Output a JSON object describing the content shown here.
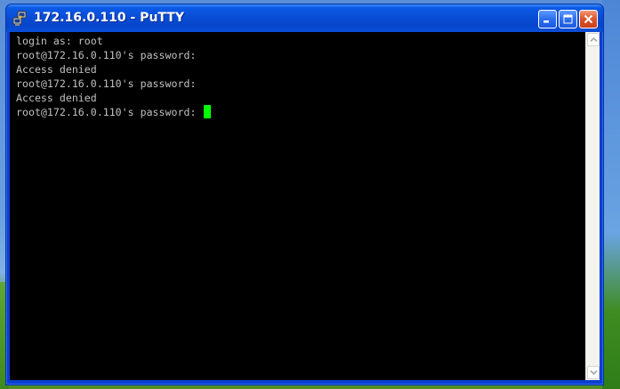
{
  "window": {
    "title": "172.16.0.110 - PuTTY",
    "app_icon": "putty-terminal-icon",
    "controls": {
      "minimize": "minimize-icon",
      "maximize": "maximize-icon",
      "close": "close-icon"
    }
  },
  "terminal": {
    "background": "#000000",
    "text_color": "#c0c0c0",
    "cursor_color": "#00ff00",
    "lines": [
      "login as: root",
      "root@172.16.0.110's password:",
      "Access denied",
      "root@172.16.0.110's password:",
      "Access denied",
      "root@172.16.0.110's password: "
    ]
  },
  "scrollbar": {
    "up_icon": "chevron-up-icon",
    "down_icon": "chevron-down-icon"
  }
}
